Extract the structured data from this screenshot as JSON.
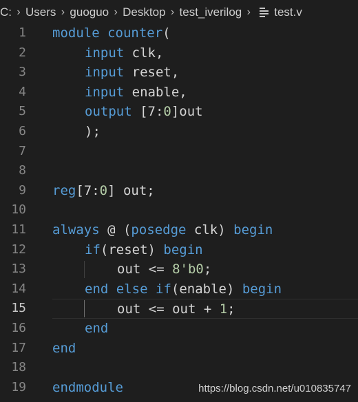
{
  "breadcrumb": {
    "items": [
      "C:",
      "Users",
      "guoguo",
      "Desktop",
      "test_iverilog",
      "test.v"
    ],
    "file_icon": "file-lines-icon"
  },
  "editor": {
    "language": "verilog",
    "current_line": 15,
    "colors": {
      "keyword": "#569cd6",
      "text": "#d4d4d4",
      "number": "#b5cea8",
      "line_number": "#858585"
    },
    "lines": [
      {
        "n": "1",
        "indent": 0,
        "tokens": [
          {
            "t": "module",
            "c": "kw"
          },
          {
            "t": " "
          },
          {
            "t": "counter",
            "c": "kw"
          },
          {
            "t": "("
          }
        ]
      },
      {
        "n": "2",
        "indent": 1,
        "tokens": [
          {
            "t": "input",
            "c": "kw"
          },
          {
            "t": " clk,"
          }
        ]
      },
      {
        "n": "3",
        "indent": 1,
        "tokens": [
          {
            "t": "input",
            "c": "kw"
          },
          {
            "t": " reset,"
          }
        ]
      },
      {
        "n": "4",
        "indent": 1,
        "tokens": [
          {
            "t": "input",
            "c": "kw"
          },
          {
            "t": " enable,"
          }
        ]
      },
      {
        "n": "5",
        "indent": 1,
        "tokens": [
          {
            "t": "output",
            "c": "kw"
          },
          {
            "t": " [7:"
          },
          {
            "t": "0",
            "c": "nm"
          },
          {
            "t": "]out"
          }
        ]
      },
      {
        "n": "6",
        "indent": 1,
        "tokens": [
          {
            "t": ");"
          }
        ]
      },
      {
        "n": "7",
        "indent": 0,
        "tokens": []
      },
      {
        "n": "8",
        "indent": 0,
        "tokens": []
      },
      {
        "n": "9",
        "indent": 0,
        "tokens": [
          {
            "t": "reg",
            "c": "kw"
          },
          {
            "t": "[7:"
          },
          {
            "t": "0",
            "c": "nm"
          },
          {
            "t": "] out;"
          }
        ]
      },
      {
        "n": "10",
        "indent": 0,
        "tokens": []
      },
      {
        "n": "11",
        "indent": 0,
        "tokens": [
          {
            "t": "always",
            "c": "kw"
          },
          {
            "t": " @ ("
          },
          {
            "t": "posedge",
            "c": "kw"
          },
          {
            "t": " clk) "
          },
          {
            "t": "begin",
            "c": "kw"
          }
        ]
      },
      {
        "n": "12",
        "indent": 1,
        "tokens": [
          {
            "t": "if",
            "c": "kw"
          },
          {
            "t": "(reset) "
          },
          {
            "t": "begin",
            "c": "kw"
          }
        ]
      },
      {
        "n": "13",
        "indent": 2,
        "tokens": [
          {
            "t": "out <= "
          },
          {
            "t": "8'b0",
            "c": "nm"
          },
          {
            "t": ";"
          }
        ]
      },
      {
        "n": "14",
        "indent": 1,
        "tokens": [
          {
            "t": "end",
            "c": "kw"
          },
          {
            "t": " "
          },
          {
            "t": "else",
            "c": "kw"
          },
          {
            "t": " "
          },
          {
            "t": "if",
            "c": "kw"
          },
          {
            "t": "(enable) "
          },
          {
            "t": "begin",
            "c": "kw"
          }
        ]
      },
      {
        "n": "15",
        "indent": 2,
        "tokens": [
          {
            "t": "out <= out + "
          },
          {
            "t": "1",
            "c": "nm"
          },
          {
            "t": ";"
          }
        ]
      },
      {
        "n": "16",
        "indent": 1,
        "tokens": [
          {
            "t": "end",
            "c": "kw"
          }
        ]
      },
      {
        "n": "17",
        "indent": 0,
        "tokens": [
          {
            "t": "end",
            "c": "kw"
          }
        ]
      },
      {
        "n": "18",
        "indent": 0,
        "tokens": []
      },
      {
        "n": "19",
        "indent": 0,
        "tokens": [
          {
            "t": "endmodule",
            "c": "kw"
          }
        ]
      }
    ]
  },
  "watermark": "https://blog.csdn.net/u010835747"
}
